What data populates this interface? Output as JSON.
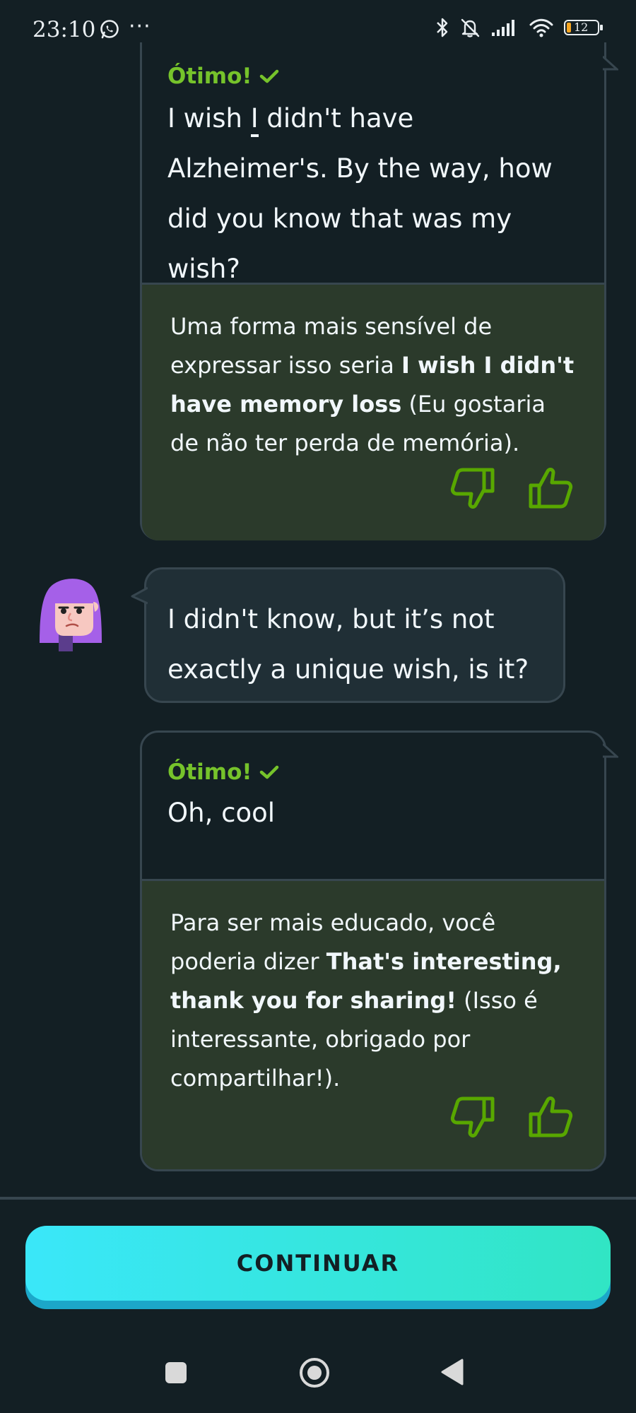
{
  "status_bar": {
    "time": "23:10",
    "dots": "···",
    "battery": "12",
    "icons": [
      "whatsapp-icon",
      "bluetooth-icon",
      "bell-off-icon",
      "signal-icon",
      "wifi-icon",
      "battery-icon"
    ]
  },
  "messages": [
    {
      "type": "user",
      "status": "Ótimo!",
      "text_parts": [
        "I wish ",
        "I",
        " didn't have Alzheimer's. By the way, how did you know that was my wish?"
      ],
      "feedback": {
        "before": "Uma forma mais sensível de expressar isso seria ",
        "bold": "I wish I didn't have memory loss",
        "after": " (Eu gostaria de não ter perda de memória)."
      }
    },
    {
      "type": "ai",
      "text": "I didn't know, but it’s not exactly a unique wish, is it?"
    },
    {
      "type": "user",
      "status": "Ótimo!",
      "text": "Oh, cool",
      "feedback": {
        "before": "Para ser mais educado, você poderia dizer ",
        "bold": "That's interesting, thank you for sharing!",
        "after": " (Isso é interessante, obrigado por compartilhar!)."
      }
    }
  ],
  "continue_label": "CONTINUAR",
  "colors": {
    "background": "#131f24",
    "success_green": "#76c32b",
    "feedback_bg": "#2b3a2b",
    "border": "#37464f",
    "ai_bubble": "#202f36",
    "button_start": "#3ae7f9",
    "button_end": "#31e5c4"
  }
}
